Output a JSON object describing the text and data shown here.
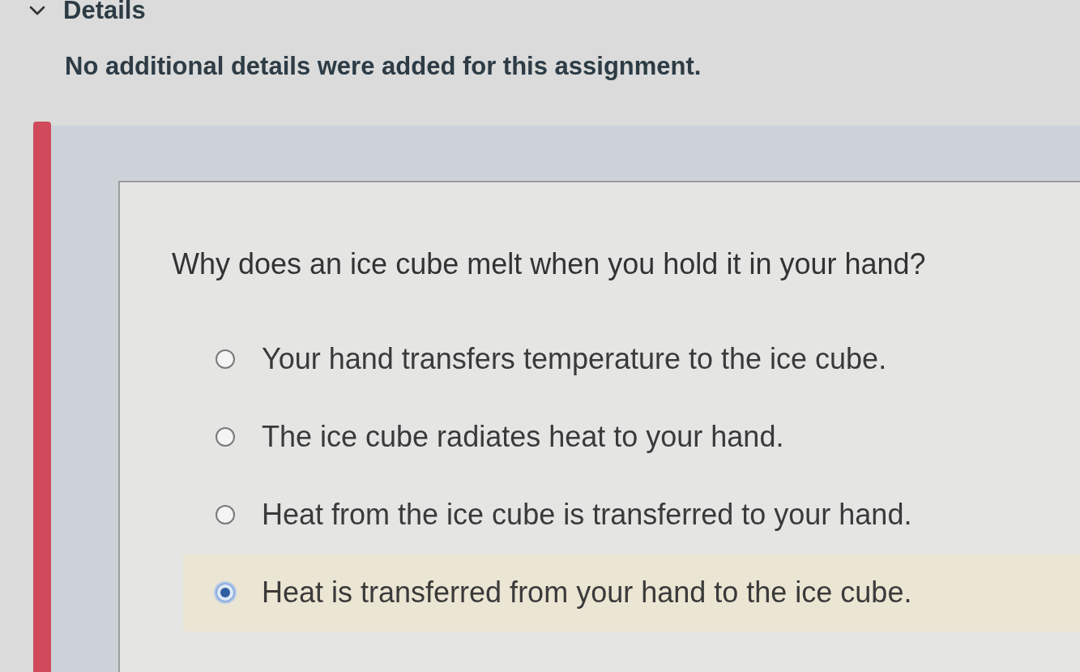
{
  "details": {
    "title": "Details",
    "expanded": true,
    "text": "No additional details were added for this assignment."
  },
  "question": {
    "prompt": "Why does an ice cube melt when you hold it in your hand?",
    "options": [
      {
        "label": "Your hand transfers temperature to the ice cube.",
        "selected": false
      },
      {
        "label": "The ice cube radiates heat to your hand.",
        "selected": false
      },
      {
        "label": "Heat from the ice cube is transferred to your hand.",
        "selected": false
      },
      {
        "label": "Heat is transferred from your hand to the ice cube.",
        "selected": true
      }
    ]
  }
}
